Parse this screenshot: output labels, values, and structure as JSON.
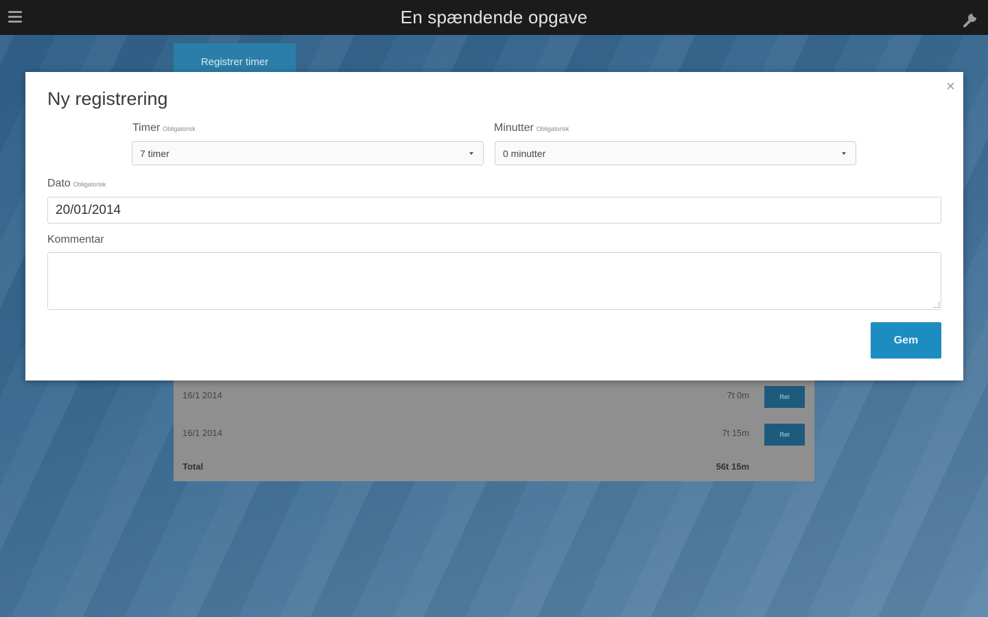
{
  "topbar": {
    "title": "En spændende opgave",
    "menu_icon": "hamburger-menu-icon",
    "settings_icon": "wrench-icon"
  },
  "background": {
    "tab_label": "Registrer timer",
    "rows": [
      {
        "date": "16/1 2014",
        "hours": "7t 0m",
        "button": "Ret"
      },
      {
        "date": "16/1 2014",
        "hours": "7t 15m",
        "button": "Ret"
      }
    ],
    "total": {
      "label": "Total",
      "hours": "56t 15m"
    }
  },
  "modal": {
    "title": "Ny registrering",
    "close_glyph": "×",
    "hours": {
      "label": "Timer",
      "required": "Obligatorisk",
      "value": "7 timer"
    },
    "minutes": {
      "label": "Minutter",
      "required": "Obligatorisk",
      "value": "0 minutter"
    },
    "date": {
      "label": "Dato",
      "required": "Obligatorisk",
      "value": "20/01/2014"
    },
    "comment": {
      "label": "Kommentar",
      "value": ""
    },
    "save_label": "Gem"
  },
  "colors": {
    "topbar": "#1b1b1b",
    "accent": "#1d8cc1",
    "background": "#3f6d94"
  }
}
